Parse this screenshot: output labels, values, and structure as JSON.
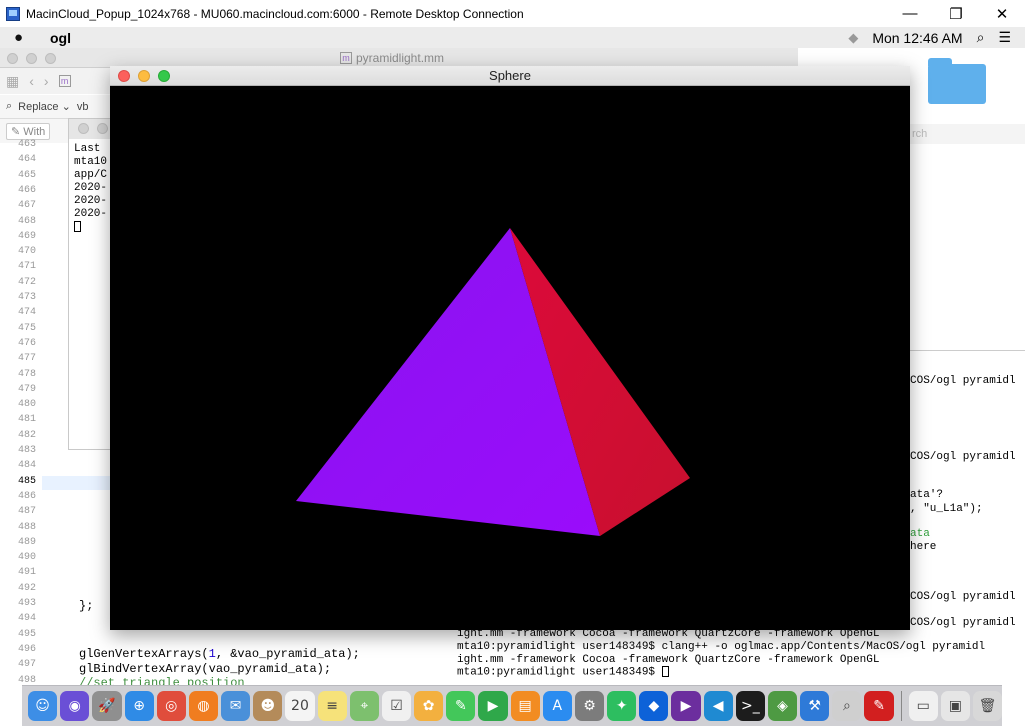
{
  "rdp": {
    "title": "MacinCloud_Popup_1024x768 - MU060.macincloud.com:6000 - Remote Desktop Connection",
    "minimize": "—",
    "restore": "❐",
    "close": "✕"
  },
  "menubar": {
    "app_name": "ogl",
    "clock": "Mon 12:46 AM"
  },
  "editor": {
    "file_name": "pyramidlight.mm",
    "replace_label": "Replace",
    "replace_field": "vb",
    "with_label": "With",
    "line_numbers": [
      "463",
      "464",
      "465",
      "466",
      "467",
      "468",
      "469",
      "470",
      "471",
      "472",
      "473",
      "474",
      "475",
      "476",
      "477",
      "478",
      "479",
      "480",
      "481",
      "482",
      "483",
      "484",
      "485",
      "486",
      "487",
      "488",
      "489",
      "490",
      "491",
      "492",
      "493",
      "494",
      "495",
      "496",
      "497",
      "498"
    ],
    "current_line": "485",
    "code_close_brace": "};",
    "code_line_496_a": "glGenVertexArrays(",
    "code_line_496_num": "1",
    "code_line_496_b": ", &vao_pyramid_ata);",
    "code_line_497": "glBindVertexArray(vao_pyramid_ata);",
    "code_line_498": "//set triangle position"
  },
  "terminal_left": {
    "lines": [
      "Last",
      "mta10",
      "app/C",
      "2020-",
      "2020-",
      "2020-"
    ]
  },
  "terminal_right": {
    "lines": [
      {
        "text": "COS/ogl pyramidl",
        "green": false
      },
      {
        "text": "COS/ogl pyramidl",
        "green": false
      },
      {
        "text": "ata'?",
        "green": false
      },
      {
        "text": ", \"u_L1a\");",
        "green": false
      },
      {
        "text": "ata",
        "green": true
      },
      {
        "text": "here",
        "green": false
      },
      {
        "text": "COS/ogl pyramidl",
        "green": false
      },
      {
        "text": "COS/ogl pyramidl",
        "green": false
      },
      {
        "text": "COS/ogl pyramidl",
        "green": false
      }
    ]
  },
  "terminal_bottom": {
    "lines": [
      "ight.mm -framework Cocoa -framework QuartzCore -framework OpenGL",
      "mta10:pyramidlight user148349$ clang++ -o oglmac.app/Contents/MacOS/ogl pyramidl",
      "ight.mm -framework Cocoa -framework QuartzCore -framework OpenGL",
      "mta10:pyramidlight user148349$ "
    ]
  },
  "sidebar_search": "rch",
  "sphere_window": {
    "title": "Sphere"
  },
  "pyramid": {
    "left_face_color": "#9a0cfb",
    "right_face_color": "#dc0a3a"
  },
  "dock": {
    "icons": [
      {
        "name": "finder-icon",
        "color": "#3d8ee6",
        "glyph": "☺"
      },
      {
        "name": "siri-icon",
        "color": "#6a4fd6",
        "glyph": "◉"
      },
      {
        "name": "launchpad-icon",
        "color": "#8f8f8f",
        "glyph": "🚀"
      },
      {
        "name": "safari-icon",
        "color": "#2f8be6",
        "glyph": "⊕"
      },
      {
        "name": "chrome-icon",
        "color": "#e04d3c",
        "glyph": "◎"
      },
      {
        "name": "firefox-icon",
        "color": "#f07d20",
        "glyph": "◍"
      },
      {
        "name": "mail-icon",
        "color": "#4a90d9",
        "glyph": "✉"
      },
      {
        "name": "contacts-icon",
        "color": "#b48b5a",
        "glyph": "☻"
      },
      {
        "name": "calendar-icon",
        "color": "#f4f4f4",
        "glyph": "20"
      },
      {
        "name": "notes-icon",
        "color": "#f6e27a",
        "glyph": "≡"
      },
      {
        "name": "maps-icon",
        "color": "#7dc06e",
        "glyph": "⌖"
      },
      {
        "name": "reminders-icon",
        "color": "#f0f0f0",
        "glyph": "☑"
      },
      {
        "name": "photos-icon",
        "color": "#f3b03f",
        "glyph": "✿"
      },
      {
        "name": "messages-icon",
        "color": "#43c75a",
        "glyph": "✎"
      },
      {
        "name": "facetime-icon",
        "color": "#2fa84a",
        "glyph": "▶"
      },
      {
        "name": "books-icon",
        "color": "#f28c22",
        "glyph": "▤"
      },
      {
        "name": "appstore-icon",
        "color": "#2b8cf0",
        "glyph": "A"
      },
      {
        "name": "system-preferences-icon",
        "color": "#7c7c7c",
        "glyph": "⚙"
      },
      {
        "name": "evernote-icon",
        "color": "#2dbe60",
        "glyph": "✦"
      },
      {
        "name": "dropbox-icon",
        "color": "#0d62d8",
        "glyph": "◆"
      },
      {
        "name": "visual-studio-icon",
        "color": "#6c2e9e",
        "glyph": "▶"
      },
      {
        "name": "vscode-icon",
        "color": "#1f8ad2",
        "glyph": "◀"
      },
      {
        "name": "terminal-icon",
        "color": "#1c1c1c",
        "glyph": ">_"
      },
      {
        "name": "android-studio-icon",
        "color": "#4e9a43",
        "glyph": "◈"
      },
      {
        "name": "xcode-icon",
        "color": "#2e7ad8",
        "glyph": "⚒"
      },
      {
        "name": "instruments-icon",
        "color": "#cfcfcf",
        "glyph": "⌕"
      },
      {
        "name": "acrobat-icon",
        "color": "#d21f1f",
        "glyph": "✎"
      },
      {
        "name": "documents-icon",
        "color": "#f0f0f0",
        "glyph": "▭"
      },
      {
        "name": "preview-icon",
        "color": "#e6e6e6",
        "glyph": "▣"
      },
      {
        "name": "trash-icon",
        "color": "#d8d8d8",
        "glyph": "🗑"
      }
    ]
  }
}
